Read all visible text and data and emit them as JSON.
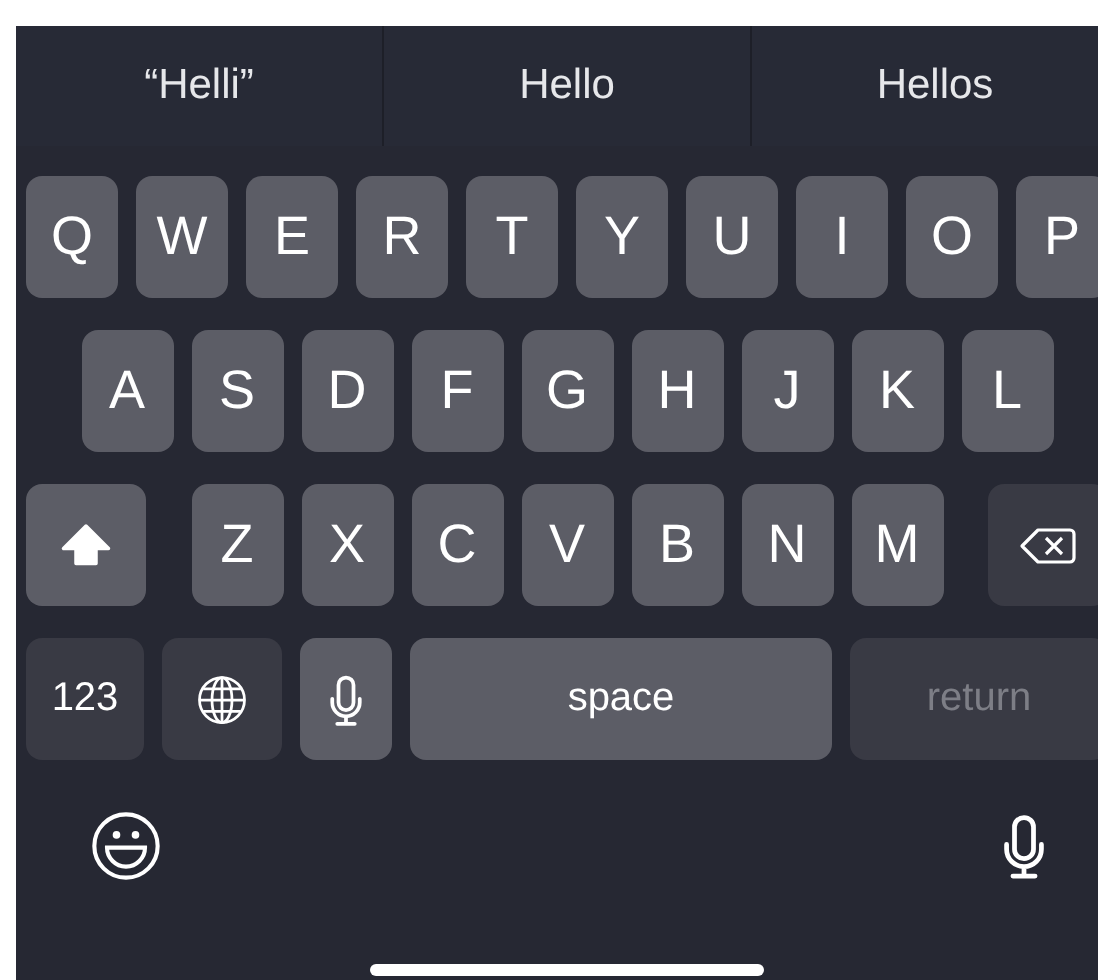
{
  "suggestions": [
    {
      "label": "“Helli”"
    },
    {
      "label": "Hello"
    },
    {
      "label": "Hellos"
    }
  ],
  "rows": [
    {
      "keys": [
        {
          "kind": "letter",
          "label": "Q"
        },
        {
          "kind": "letter",
          "label": "W"
        },
        {
          "kind": "letter",
          "label": "E"
        },
        {
          "kind": "letter",
          "label": "R"
        },
        {
          "kind": "letter",
          "label": "T"
        },
        {
          "kind": "letter",
          "label": "Y"
        },
        {
          "kind": "letter",
          "label": "U"
        },
        {
          "kind": "letter",
          "label": "I"
        },
        {
          "kind": "letter",
          "label": "O"
        },
        {
          "kind": "letter",
          "label": "P"
        }
      ]
    },
    {
      "keys": [
        {
          "kind": "letter",
          "label": "A"
        },
        {
          "kind": "letter",
          "label": "S"
        },
        {
          "kind": "letter",
          "label": "D"
        },
        {
          "kind": "letter",
          "label": "F"
        },
        {
          "kind": "letter",
          "label": "G"
        },
        {
          "kind": "letter",
          "label": "H"
        },
        {
          "kind": "letter",
          "label": "J"
        },
        {
          "kind": "letter",
          "label": "K"
        },
        {
          "kind": "letter",
          "label": "L"
        }
      ]
    },
    {
      "keys": [
        {
          "kind": "shift",
          "on": true
        },
        {
          "kind": "letter",
          "label": "Z"
        },
        {
          "kind": "letter",
          "label": "X"
        },
        {
          "kind": "letter",
          "label": "C"
        },
        {
          "kind": "letter",
          "label": "V"
        },
        {
          "kind": "letter",
          "label": "B"
        },
        {
          "kind": "letter",
          "label": "N"
        },
        {
          "kind": "letter",
          "label": "M"
        },
        {
          "kind": "backspace"
        }
      ]
    },
    {
      "keys": [
        {
          "kind": "numbers",
          "label": "123"
        },
        {
          "kind": "globe"
        },
        {
          "kind": "mic"
        },
        {
          "kind": "space",
          "label": "space"
        },
        {
          "kind": "return",
          "label": "return",
          "disabled": true
        }
      ]
    }
  ]
}
